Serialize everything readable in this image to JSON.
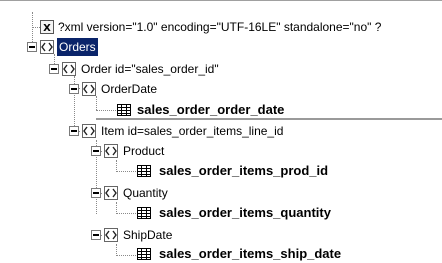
{
  "tree": {
    "xml_declaration": "?xml version=\"1.0\" encoding=\"UTF-16LE\" standalone=\"no\" ?",
    "orders": "Orders",
    "order": "Order id=\"sales_order_id\"",
    "order_date": "OrderDate",
    "order_date_column": "sales_order_order_date",
    "item": "Item id=sales_order_items_line_id",
    "product": "Product",
    "product_column": "sales_order_items_prod_id",
    "quantity": "Quantity",
    "quantity_column": "sales_order_items_quantity",
    "ship_date": "ShipDate",
    "ship_date_column": "sales_order_items_ship_date"
  },
  "colors": {
    "selection": "#0a246a",
    "tree_lines": "#8a8a8a"
  },
  "icons": {
    "declaration": "xml-declaration-icon",
    "element": "xml-element-icon",
    "column": "table-column-icon"
  }
}
